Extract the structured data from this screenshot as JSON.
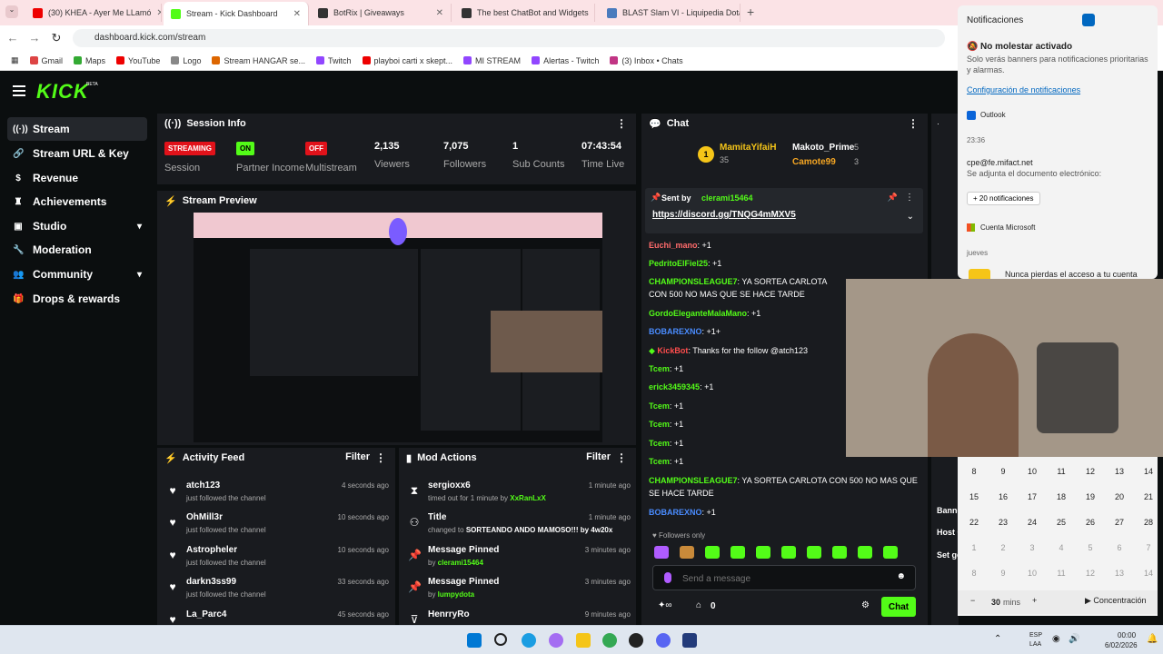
{
  "browser": {
    "tabs": [
      {
        "title": "(30) KHEA - Ayer Me LLamó",
        "color": "#e00"
      },
      {
        "title": "Stream - Kick Dashboard",
        "color": "#53fc18"
      },
      {
        "title": "BotRix | Giveaways",
        "color": "#333"
      },
      {
        "title": "The best ChatBot and Widgets",
        "color": "#333"
      },
      {
        "title": "BLAST Slam VI - Liquipedia Dota",
        "color": "#4a7bbd"
      }
    ],
    "url": "dashboard.kick.com/stream",
    "bookmarks": [
      "Gmail",
      "Maps",
      "YouTube",
      "Logo",
      "Stream HANGAR se...",
      "Twitch",
      "playboi carti x skept...",
      "MI STREAM",
      "Alertas - Twitch",
      "(3) Inbox • Chats"
    ]
  },
  "kick": {
    "logo": "KICK",
    "beta": "BETA",
    "sidebar": [
      {
        "label": "Stream",
        "icon": "broadcast-icon"
      },
      {
        "label": "Stream URL & Key",
        "icon": "link-icon"
      },
      {
        "label": "Revenue",
        "icon": "dollar-icon"
      },
      {
        "label": "Achievements",
        "icon": "trophy-icon"
      },
      {
        "label": "Studio",
        "icon": "studio-icon"
      },
      {
        "label": "Moderation",
        "icon": "wrench-icon"
      },
      {
        "label": "Community",
        "icon": "people-icon"
      },
      {
        "label": "Drops & rewards",
        "icon": "gift-icon"
      }
    ],
    "session": {
      "title": "Session Info",
      "streaming": "STREAMING",
      "session_label": "Session",
      "partner_badge": "ON",
      "partner_label": "Partner Income",
      "multistream_badge": "OFF",
      "multistream_label": "Multistream",
      "viewers": "2,135",
      "viewers_label": "Viewers",
      "followers": "7,075",
      "followers_label": "Followers",
      "subs": "1",
      "subs_label": "Sub Counts",
      "time": "07:43:54",
      "time_label": "Time Live"
    },
    "preview": {
      "title": "Stream Preview"
    },
    "activity": {
      "title": "Activity Feed",
      "filter": "Filter",
      "items": [
        {
          "name": "atch123",
          "sub": "just followed the channel",
          "time": "4 seconds ago"
        },
        {
          "name": "OhMill3r",
          "sub": "just followed the channel",
          "time": "10 seconds ago"
        },
        {
          "name": "Astropheler",
          "sub": "just followed the channel",
          "time": "10 seconds ago"
        },
        {
          "name": "darkn3ss99",
          "sub": "just followed the channel",
          "time": "33 seconds ago"
        },
        {
          "name": "La_Parc4",
          "sub": "just followed the channel",
          "time": "45 seconds ago"
        }
      ]
    },
    "mod": {
      "title": "Mod Actions",
      "filter": "Filter",
      "items": [
        {
          "name": "sergioxx6",
          "pre": "timed out for 1 minute by ",
          "by": "XxRanLxX",
          "time": "1 minute ago",
          "icon": "hourglass-icon"
        },
        {
          "name": "Title",
          "pre": "changed to ",
          "by": "SORTEANDO ANDO MAMOSO!!! by 4w20x",
          "time": "1 minute ago",
          "icon": "title-icon"
        },
        {
          "name": "Message Pinned",
          "pre": "by ",
          "by": "clerami15464",
          "time": "3 minutes ago",
          "icon": "pin-icon"
        },
        {
          "name": "Message Pinned",
          "pre": "by ",
          "by": "lumpydota",
          "time": "3 minutes ago",
          "icon": "pin-icon"
        },
        {
          "name": "HenrryRo",
          "pre": "",
          "by": "",
          "time": "9 minutes ago",
          "icon": "user-icon"
        }
      ]
    },
    "chat": {
      "title": "Chat",
      "top": [
        {
          "name": "MamitaYifaiH",
          "value": "35"
        },
        {
          "name": "Makoto_Prime",
          "value": "5"
        },
        {
          "name": "Camote99",
          "value": "3"
        }
      ],
      "pinned_by_label": "Sent by",
      "pinned_by": "clerami15464",
      "pinned_link": "https://discord.gg/TNQG4mMXV5",
      "messages": [
        {
          "user": "Euchi_mano",
          "text": "+1",
          "color": "#ff6b6b"
        },
        {
          "user": "PedritoElFiel25",
          "text": "+1",
          "color": "#53fc18"
        },
        {
          "user": "CHAMPIONSLEAGUE7",
          "text": "YA SORTEA CARLOTA CON 500 NO MAS QUE SE HACE TARDE",
          "color": "#53fc18"
        },
        {
          "user": "GordoEleganteMalaMano",
          "text": "+1",
          "color": "#53fc18"
        },
        {
          "user": "BOBAREXNO",
          "text": "+1+",
          "color": "#4a8cff"
        },
        {
          "user": "KickBot",
          "text": "Thanks for the follow @atch123",
          "color": "#ff4d4d"
        },
        {
          "user": "Tcem",
          "text": "+1",
          "color": "#53fc18"
        },
        {
          "user": "erick3459345",
          "text": "+1",
          "color": "#53fc18"
        },
        {
          "user": "Tcem",
          "text": "+1",
          "color": "#53fc18"
        },
        {
          "user": "Tcem",
          "text": "+1",
          "color": "#53fc18"
        },
        {
          "user": "Tcem",
          "text": "+1",
          "color": "#53fc18"
        },
        {
          "user": "Tcem",
          "text": "+1",
          "color": "#53fc18"
        },
        {
          "user": "CHAMPIONSLEAGUE7",
          "text": "YA SORTEA CARLOTA CON 500 NO MAS QUE SE HACE TARDE",
          "color": "#53fc18"
        },
        {
          "user": "BOBAREXNO",
          "text": "+1",
          "color": "#4a8cff"
        }
      ],
      "followers_only": "Followers only",
      "placeholder": "Send a message",
      "points": "0",
      "chat_button": "Chat"
    },
    "right_panel": {
      "labels": [
        "Banned words",
        "Host Channel",
        "Set goals"
      ]
    }
  },
  "notifications": {
    "title": "Notificaciones",
    "dnd_title": "No molestar activado",
    "dnd_text": "Solo verás banners para notificaciones prioritarias y alarmas.",
    "settings_link": "Configuración de notificaciones",
    "outlook": "Outlook",
    "time": "23:36",
    "email_from": "cpe@fe.mifact.net",
    "email_text": "Se adjunta el documento electrónico:",
    "more": "+ 20 notificaciones",
    "ms_account": "Cuenta Microsoft",
    "day": "jueves",
    "ms_text": "Nunca pierdas el acceso a tu cuenta"
  },
  "calendar": {
    "rows": [
      [
        "8",
        "9",
        "10",
        "11",
        "12",
        "13",
        "14"
      ],
      [
        "15",
        "16",
        "17",
        "18",
        "19",
        "20",
        "21"
      ],
      [
        "22",
        "23",
        "24",
        "25",
        "26",
        "27",
        "28"
      ],
      [
        "1",
        "2",
        "3",
        "4",
        "5",
        "6",
        "7"
      ],
      [
        "8",
        "9",
        "10",
        "11",
        "12",
        "13",
        "14"
      ]
    ],
    "minutes": "30",
    "minutes_unit": "mins",
    "focus": "Concentración"
  },
  "taskbar": {
    "lang": "ESP",
    "lang2": "LAA",
    "clock": "00:00",
    "date": "6/02/2026"
  }
}
